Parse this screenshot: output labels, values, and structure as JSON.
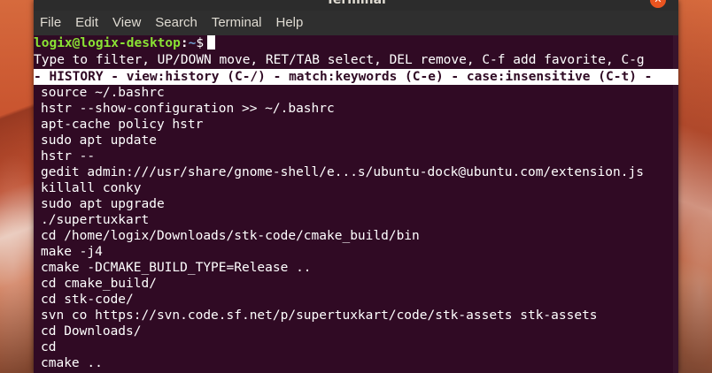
{
  "window": {
    "title": "Terminal",
    "close_glyph": "✕"
  },
  "menu": [
    "File",
    "Edit",
    "View",
    "Search",
    "Terminal",
    "Help"
  ],
  "prompt": {
    "user_host": "logix@logix-desktop",
    "colon": ":",
    "path": "~",
    "dollar": "$"
  },
  "help_line": "Type to filter, UP/DOWN move, RET/TAB select, DEL remove, C-f add favorite, C-g",
  "status_line": "- HISTORY - view:history (C-/) - match:keywords (C-e) - case:insensitive (C-t) -",
  "history": [
    "source ~/.bashrc",
    "hstr --show-configuration >> ~/.bashrc",
    "apt-cache policy hstr",
    "sudo apt update",
    "hstr --",
    "gedit admin:///usr/share/gnome-shell/e...s/ubuntu-dock@ubuntu.com/extension.js",
    "killall conky",
    "sudo apt upgrade",
    "./supertuxkart",
    "cd /home/logix/Downloads/stk-code/cmake_build/bin",
    "make -j4",
    "cmake -DCMAKE_BUILD_TYPE=Release ..",
    "cd cmake_build/",
    "cd stk-code/",
    "svn co https://svn.code.sf.net/p/supertuxkart/code/stk-assets stk-assets",
    "cd Downloads/",
    "cd",
    "cmake .."
  ],
  "colors": {
    "terminal_bg": "#300a24",
    "prompt_user": "#8ae234",
    "prompt_path": "#729fcf",
    "accent": "#e95420"
  }
}
